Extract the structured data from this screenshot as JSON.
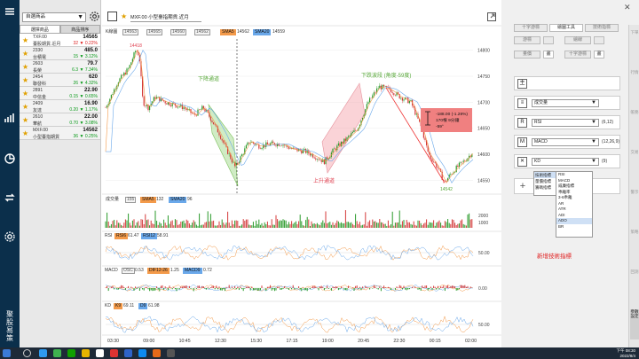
{
  "brand": {
    "text": "聚股易策"
  },
  "watchlist": {
    "selector": "自選商品",
    "tabs": [
      "選擇商品",
      "商品排序"
    ],
    "rows": [
      {
        "symbol": "TXF.00",
        "name": "臺股期貨.近月",
        "price": "14565",
        "change": "32 ▼ 0.22%",
        "dir": "dn",
        "selected": true
      },
      {
        "symbol": "2330",
        "name": "台積電",
        "price": "485.0",
        "change": "15 ▼ 3.12%",
        "dir": "up"
      },
      {
        "symbol": "2603",
        "name": "長榮",
        "price": "79.7",
        "change": "6.3 ▼ 7.34%",
        "dir": "up"
      },
      {
        "symbol": "2454",
        "name": "聯發科",
        "price": "620",
        "change": "26 ▼ 4.32%",
        "dir": "up"
      },
      {
        "symbol": "2891",
        "name": "中信金",
        "price": "22.90",
        "change": "0.15 ▼ 0.65%",
        "dir": "up"
      },
      {
        "symbol": "2409",
        "name": "友達",
        "price": "16.90",
        "change": "0.20 ▼ 1.17%",
        "dir": "up"
      },
      {
        "symbol": "2610",
        "name": "華航",
        "price": "22.00",
        "change": "0.70 ▼ 3.08%",
        "dir": "up"
      },
      {
        "symbol": "MXF.00",
        "name": "小型臺指期貨",
        "price": "14562",
        "change": "36 ▼ 0.25%",
        "dir": "up"
      }
    ]
  },
  "chart_header": {
    "title": "MXF.00  小型臺指期貨.近月",
    "kline_label": "K線圖",
    "ohlc": [
      "14563",
      "14565",
      "14560",
      "14562"
    ],
    "sma_tag": "SMA5",
    "sma_value": "14562",
    "sma2_tag": "SMA20",
    "sma2_value": "14559"
  },
  "annotations": {
    "down_channel": "下降通道",
    "up_channel": "上升通道",
    "wave": "下跌波段 (角度-59度)",
    "high_label": "14418",
    "low_label": "14542",
    "measure_line1": "-188.00 (-1.28%)",
    "measure_line2": "170根  9分鐘",
    "measure_line3": "-59°"
  },
  "price_axis": [
    "14800",
    "14750",
    "14700",
    "14650",
    "14600",
    "14550"
  ],
  "volume": {
    "label": "成交量",
    "v1": "155",
    "sma_tag": "SMA5",
    "sma_val": "132",
    "sma2_tag": "SMA20",
    "sma2_val": "96",
    "axis": [
      "2000",
      "1000"
    ]
  },
  "rsi": {
    "label": "RSI",
    "tag1": "RSI6",
    "val1": "61.47",
    "tag2": "RSI12",
    "val2": "58.91",
    "axis": [
      "50.00"
    ]
  },
  "macd": {
    "label": "MACD",
    "tag0": "OSC",
    "val0": "0.53",
    "tag1": "DIF12-26",
    "val1": "1.25",
    "tag2": "MACD9",
    "val2": "0.72",
    "axis": [
      "0.00"
    ]
  },
  "kd": {
    "label": "KD",
    "tag1": "K9",
    "val1": "69.11",
    "tag2": "D9",
    "val2": "61.98",
    "axis": [
      "50.00"
    ]
  },
  "time_axis": [
    "03:30",
    "09:00",
    "10:45",
    "12:30",
    "15:30",
    "17:15",
    "19:00",
    "20:45",
    "22:30",
    "00:15",
    "02:00"
  ],
  "right_panel": {
    "buttons_row1": [
      "十字游標",
      "繪圖工具",
      "技術指標"
    ],
    "buttons_row2": [
      "游標",
      "繪線",
      "選擇"
    ],
    "buttons_row3": [
      "量價",
      "畫",
      "十字游標",
      "畫"
    ],
    "indicators": [
      {
        "box": "主",
        "name": "",
        "param": ""
      },
      {
        "box": "≡",
        "name": "成交量",
        "param": ""
      },
      {
        "box": "R",
        "name": "RSI",
        "param": "(6,12)"
      },
      {
        "box": "M",
        "name": "MACD",
        "param": "(12,26,9)"
      },
      {
        "box": "✕",
        "name": "KD",
        "param": "(9)"
      }
    ],
    "popmenu": [
      "技術指標",
      "量價指標",
      "籌碼指標"
    ],
    "dropdown": [
      "RSI",
      "MACD",
      "威廉指標",
      "乖離率",
      "3-6乖離",
      "AR",
      "ATR",
      "ADI",
      "ADO",
      "BR"
    ],
    "hint": "新增技術指標"
  },
  "vtabs": [
    "下單",
    "行情",
    "帳務",
    "交易",
    "警示",
    "策略",
    "回測",
    "參數設定"
  ],
  "clock": {
    "time": "下午 08:30",
    "date": "2022/8/4"
  },
  "colors": {
    "nav": "#0b2f4b",
    "up": "#0a9a1a",
    "down": "#d22222",
    "accent": "#e02020"
  }
}
